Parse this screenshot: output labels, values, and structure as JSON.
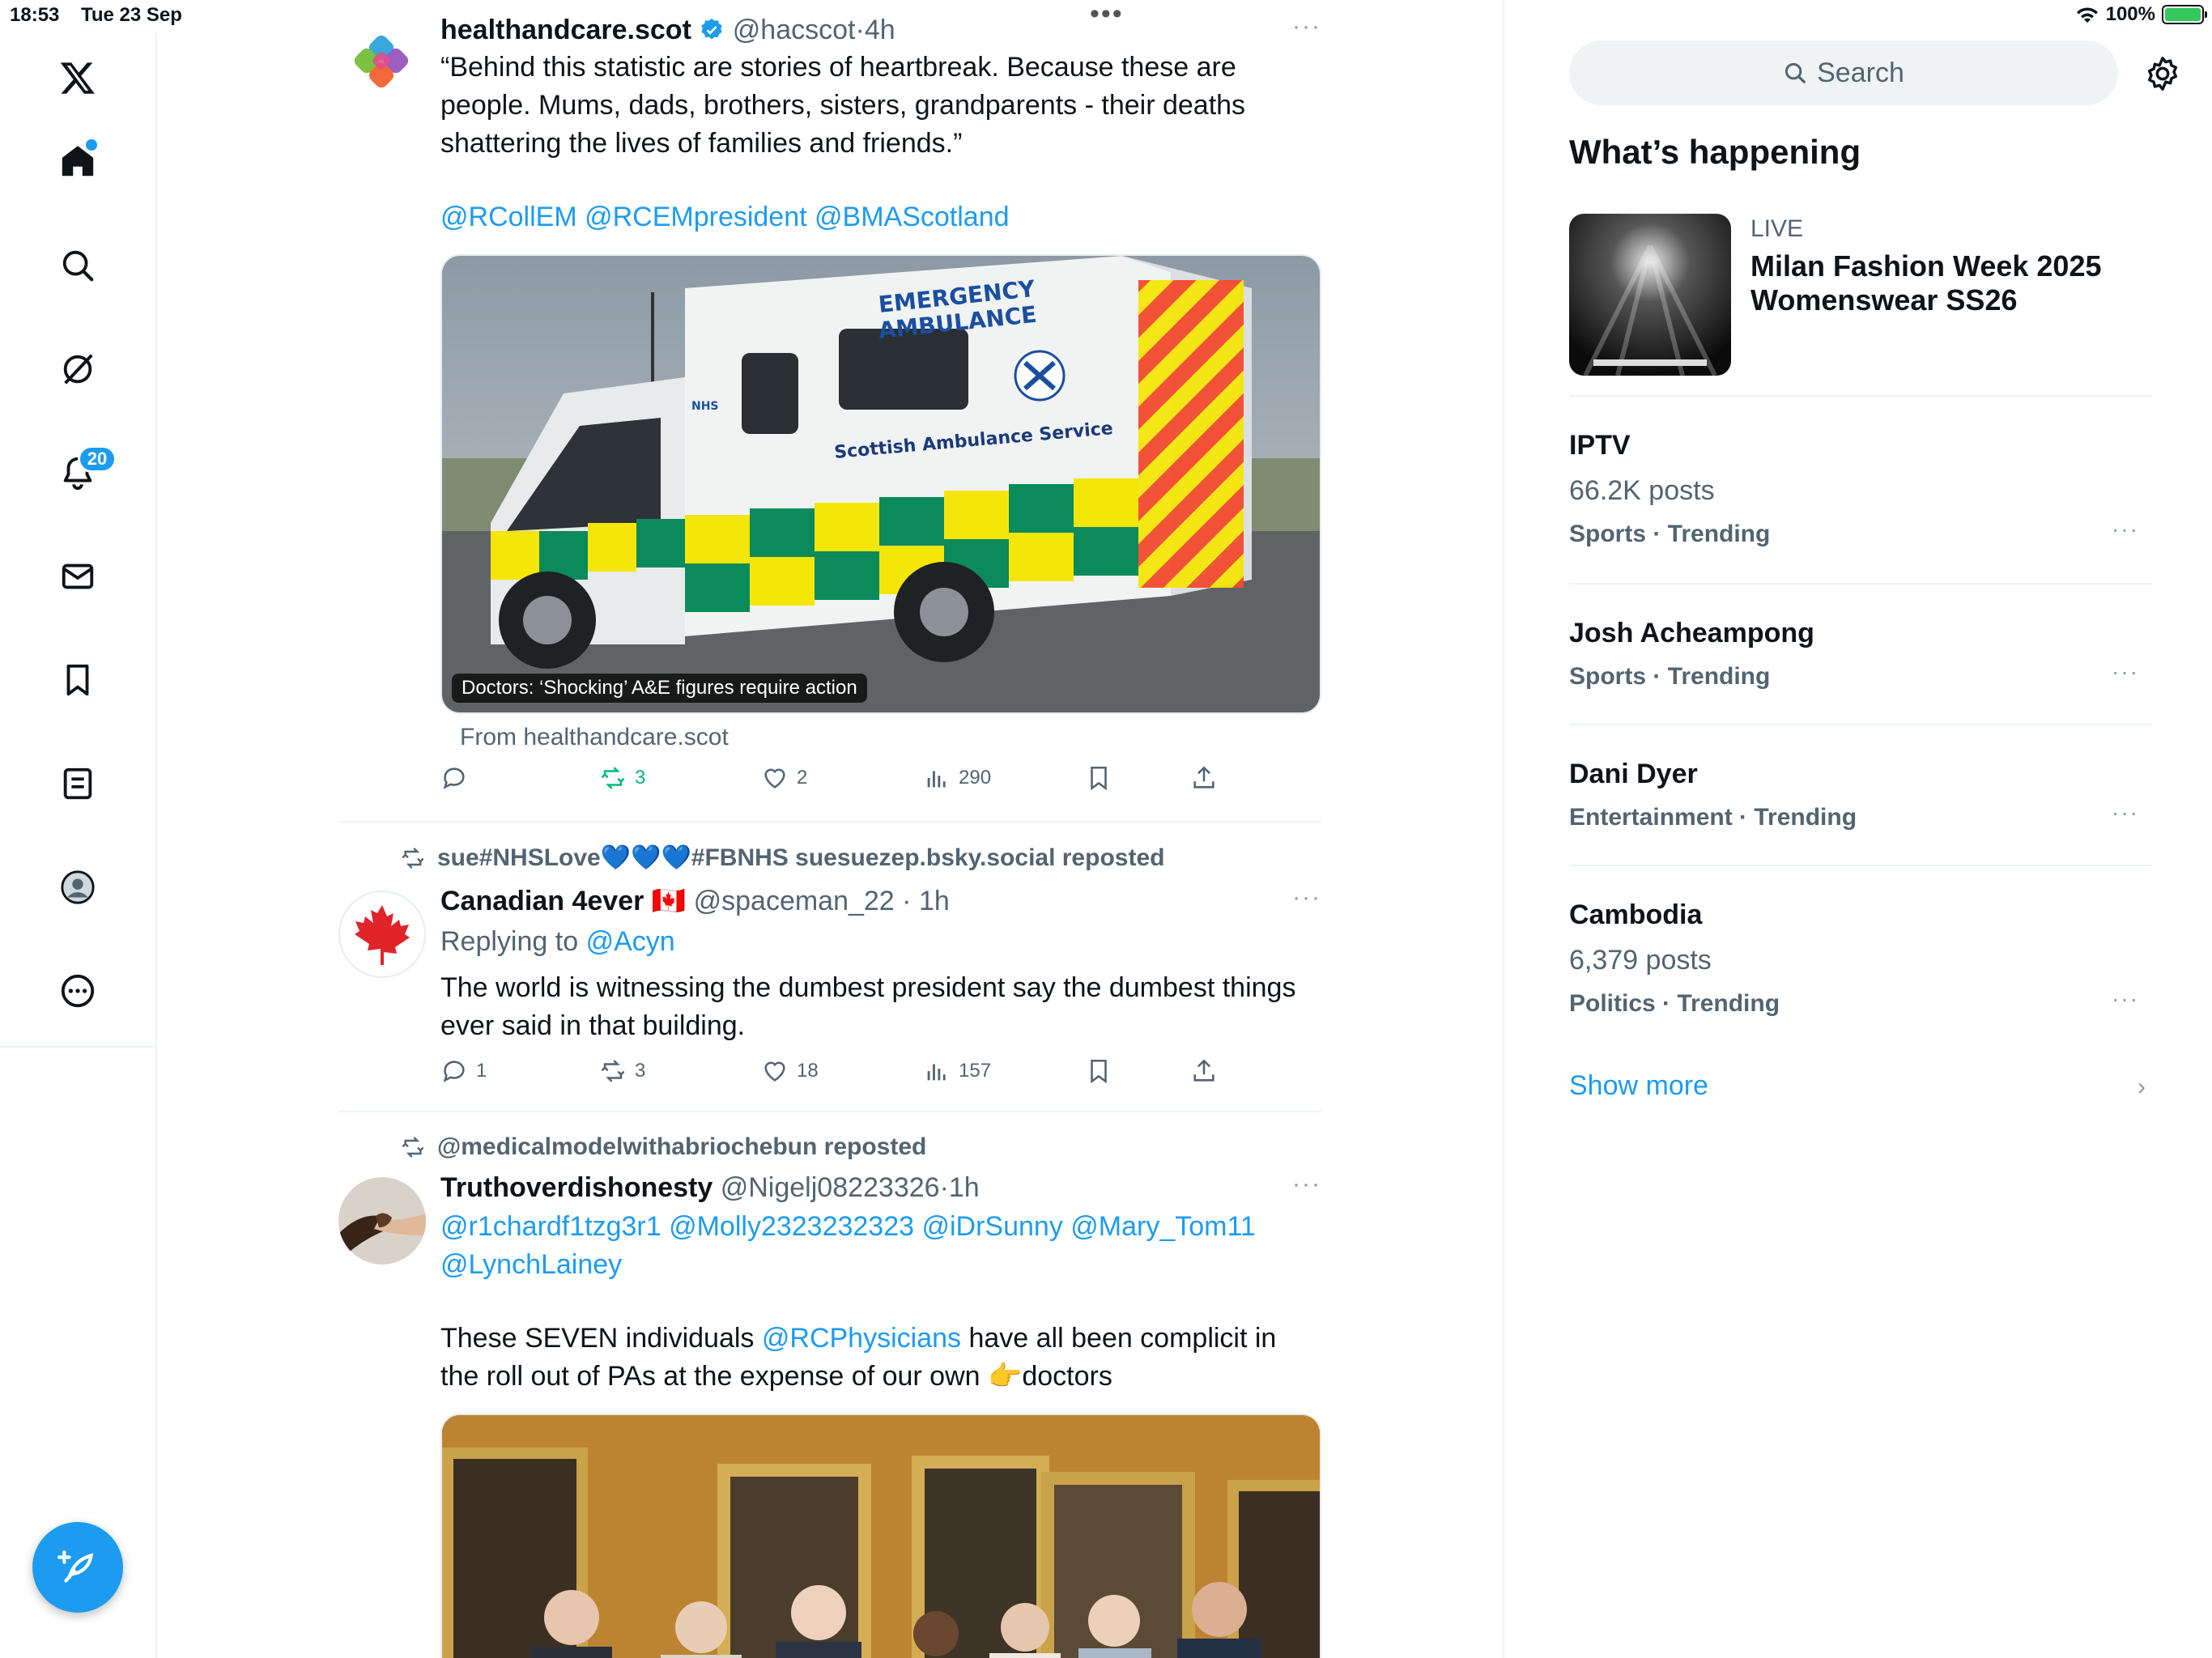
{
  "status_bar": {
    "time": "18:53",
    "date": "Tue 23 Sep",
    "battery": "100%"
  },
  "nav": {
    "notifications_badge": "20"
  },
  "feed": {
    "tweets": [
      {
        "name": "healthandcare.scot",
        "handle": "@hacscot",
        "time": "4h",
        "text": "“Behind this statistic are stories of heartbreak. Because these are people. Mums, dads, brothers, sisters, grandparents - their deaths shattering the lives of families and friends.”",
        "mentions": "@RCollEM @RCEMpresident @BMAScotland",
        "card_caption": "Doctors: ‘Shocking’ A&E figures require action",
        "card_source": "From healthandcare.scot",
        "ambulance_text1": "EMERGENCY",
        "ambulance_text2": "AMBULANCE",
        "ambulance_text3": "Scottish Ambulance Service",
        "ambulance_text4": "NHS",
        "retweets": "3",
        "likes": "2",
        "views": "290"
      },
      {
        "reposted_by": "sue#NHSLove💙💙💙#FBNHS suesuezep.bsky.social reposted",
        "name": "Canadian 4ever",
        "flag": "🇨🇦",
        "handle": "@spaceman_22",
        "time": "1h",
        "replying_label": "Replying to",
        "replying_to": "@Acyn",
        "text": "The world is witnessing the dumbest president say the dumbest things ever said in that building.",
        "replies": "1",
        "retweets": "3",
        "likes": "18",
        "views": "157"
      },
      {
        "reposted_by": "@medicalmodelwithabriochebun reposted",
        "name": "Truthoverdishonesty",
        "handle": "@Nigelj08223326",
        "time": "1h",
        "mentions": "@r1chardf1tzg3r1 @Molly2323232323 @iDrSunny @Mary_Tom11 @LynchLainey",
        "text_before": "These SEVEN individuals ",
        "text_mention": "@RCPhysicians",
        "text_after": " have all been complicit in the roll out of PAs at the expense of our own 👉doctors"
      }
    ]
  },
  "sidebar": {
    "search_placeholder": "Search",
    "whats_happening": "What’s happening",
    "live": {
      "label": "LIVE",
      "title": "Milan Fashion Week 2025 Womenswear SS26"
    },
    "trends": [
      {
        "name": "IPTV",
        "posts": "66.2K posts",
        "meta": "Sports · Trending"
      },
      {
        "name": "Josh Acheampong",
        "posts": "",
        "meta": "Sports · Trending"
      },
      {
        "name": "Dani Dyer",
        "posts": "",
        "meta": "Entertainment · Trending"
      },
      {
        "name": "Cambodia",
        "posts": "6,379 posts",
        "meta": "Politics · Trending"
      }
    ],
    "show_more": "Show more"
  },
  "colors": {
    "accent": "#1d9bf0",
    "repost_green": "#00ba7c",
    "text": "#0f1419",
    "secondary": "#536471"
  }
}
